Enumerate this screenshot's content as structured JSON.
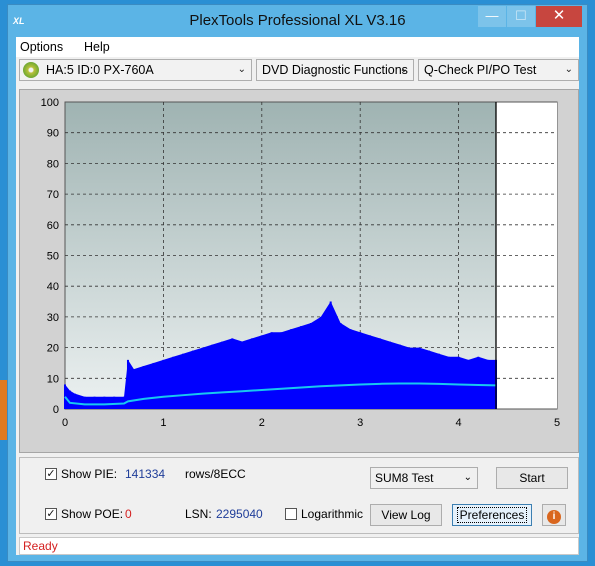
{
  "window": {
    "title": "PlexTools Professional XL V3.16",
    "icon_label": "XL",
    "min_glyph": "—",
    "max_glyph": "☐",
    "close_glyph": "✕"
  },
  "menu": {
    "options": "Options",
    "help": "Help"
  },
  "toolbar": {
    "drive": "HA:5 ID:0  PX-760A",
    "function": "DVD Diagnostic Functions",
    "test": "Q-Check PI/PO Test",
    "dropdown_glyph": "⌄"
  },
  "controls": {
    "show_pie_label": "Show PIE:",
    "pie_value": "141334",
    "pie_unit": "rows/8ECC",
    "show_poe_label": "Show POE:",
    "poe_value": "0",
    "lsn_label": "LSN:",
    "lsn_value": "2295040",
    "log_label": "Logarithmic",
    "sum_select": "SUM8 Test",
    "start_button": "Start",
    "viewlog_button": "View Log",
    "pref_button": "Preferences",
    "info_glyph": "i",
    "check_glyph": "✓",
    "show_pie_checked": true,
    "show_poe_checked": true,
    "log_checked": false
  },
  "status": {
    "text": "Ready"
  },
  "colors": {
    "plot_top": "#9fb3b2",
    "plot_bottom": "#ecf1f1",
    "pie_bars": "#0000ff",
    "trend_line": "#18c8f0",
    "status_red": "#d42121"
  },
  "chart_data": {
    "type": "bar",
    "xlim": [
      0,
      5
    ],
    "ylim": [
      0,
      100
    ],
    "x_ticks": [
      "0",
      "1",
      "2",
      "3",
      "4",
      "5"
    ],
    "y_ticks": [
      "0",
      "10",
      "20",
      "30",
      "40",
      "50",
      "60",
      "70",
      "80",
      "90",
      "100"
    ],
    "grid": true,
    "end_marker_x": 4.38,
    "series": [
      {
        "x": [
          0.0,
          0.05,
          0.1,
          0.2,
          0.3,
          0.4,
          0.5,
          0.6,
          0.64,
          0.7,
          0.8,
          0.9,
          1.0,
          1.1,
          1.2,
          1.3,
          1.4,
          1.5,
          1.6,
          1.7,
          1.8,
          1.9,
          2.0,
          2.1,
          2.2,
          2.3,
          2.4,
          2.5,
          2.6,
          2.7,
          2.8,
          2.9,
          3.0,
          3.1,
          3.2,
          3.3,
          3.4,
          3.5,
          3.6,
          3.7,
          3.8,
          3.9,
          4.0,
          4.1,
          4.2,
          4.3,
          4.38
        ],
        "values": [
          8,
          6,
          5,
          4,
          4,
          4,
          4,
          4,
          16,
          13,
          14,
          15,
          16,
          17,
          18,
          19,
          20,
          21,
          22,
          23,
          22,
          23,
          24,
          25,
          25,
          26,
          27,
          28,
          30,
          35,
          28,
          26,
          25,
          24,
          23,
          22,
          21,
          20,
          20,
          19,
          18,
          17,
          17,
          16,
          17,
          16,
          16
        ]
      },
      {
        "x": [
          0.0,
          0.05,
          0.2,
          0.4,
          0.6,
          0.64,
          0.8,
          1.0,
          1.2,
          1.4,
          1.6,
          1.8,
          2.0,
          2.2,
          2.4,
          2.6,
          2.8,
          3.0,
          3.2,
          3.4,
          3.6,
          3.8,
          4.0,
          4.2,
          4.38
        ],
        "values": [
          4,
          2,
          1.5,
          1.5,
          1.8,
          2.5,
          3.3,
          4.0,
          4.5,
          5.0,
          5.4,
          5.8,
          6.2,
          6.6,
          7.0,
          7.4,
          7.7,
          8.0,
          8.2,
          8.3,
          8.3,
          8.2,
          8.0,
          7.8,
          7.7
        ]
      }
    ]
  }
}
